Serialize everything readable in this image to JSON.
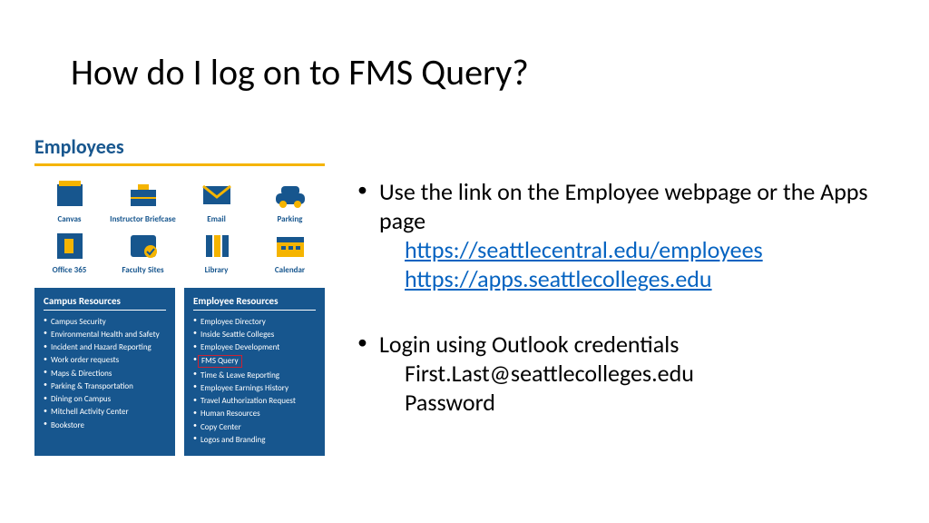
{
  "title": "How do I log on to FMS Query?",
  "screenshot": {
    "header": "Employees",
    "apps": [
      {
        "label": "Canvas",
        "icon": "canvas"
      },
      {
        "label": "Instructor Briefcase",
        "icon": "briefcase"
      },
      {
        "label": "Email",
        "icon": "email"
      },
      {
        "label": "Parking",
        "icon": "parking"
      },
      {
        "label": "Office 365",
        "icon": "office365"
      },
      {
        "label": "Faculty Sites",
        "icon": "faculty"
      },
      {
        "label": "Library",
        "icon": "library"
      },
      {
        "label": "Calendar",
        "icon": "calendar"
      }
    ],
    "campus_title": "Campus Resources",
    "campus_items": [
      "Campus Security",
      "Environmental Health and Safety",
      "Incident and Hazard Reporting",
      "Work order requests",
      "Maps & Directions",
      "Parking & Transportation",
      "Dining on Campus",
      "Mitchell Activity Center",
      "Bookstore"
    ],
    "employee_title": "Employee Resources",
    "employee_items": [
      "Employee Directory",
      "Inside Seattle Colleges",
      "Employee Development",
      "FMS Query",
      "Time & Leave Reporting",
      "Employee Earnings History",
      "Travel Authorization Request",
      "Human Resources",
      "Copy Center",
      "Logos and Branding"
    ],
    "highlighted_item": "FMS Query"
  },
  "bullets": [
    {
      "text": "Use the link on the Employee webpage or the Apps page",
      "links": [
        "https://seattlecentral.edu/employees",
        "https://apps.seattlecolleges.edu"
      ]
    },
    {
      "text": "Login using Outlook credentials",
      "sub": [
        "First.Last@seattlecolleges.edu",
        "Password"
      ]
    }
  ],
  "colors": {
    "brand_blue": "#17568e",
    "accent_yellow": "#f5b400",
    "link": "#0563c1"
  }
}
